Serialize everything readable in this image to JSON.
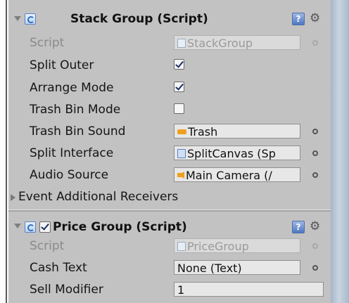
{
  "components": [
    {
      "title": "Stack Group (Script)",
      "has_checkbox": false,
      "rows": [
        {
          "label": "Script",
          "type": "object",
          "value": "StackGroup",
          "icon": "script-icon",
          "disabled": true
        },
        {
          "label": "Split Outer",
          "type": "checkbox",
          "checked": true
        },
        {
          "label": "Arrange Mode",
          "type": "checkbox",
          "checked": true
        },
        {
          "label": "Trash Bin Mode",
          "type": "checkbox",
          "checked": false
        },
        {
          "label": "Trash Bin Sound",
          "type": "object",
          "value": "Trash",
          "icon": "audio-clip-icon"
        },
        {
          "label": "Split Interface",
          "type": "object",
          "value": "SplitCanvas (Sp",
          "icon": "script-icon"
        },
        {
          "label": "Audio Source",
          "type": "object",
          "value": "Main Camera (/",
          "icon": "audio-source-icon"
        },
        {
          "label": "Event Additional Receivers",
          "type": "foldout"
        }
      ]
    },
    {
      "title": "Price Group (Script)",
      "has_checkbox": true,
      "checked": true,
      "rows": [
        {
          "label": "Script",
          "type": "object",
          "value": "PriceGroup",
          "icon": "script-icon",
          "disabled": true
        },
        {
          "label": "Cash Text",
          "type": "object",
          "value": "None (Text)"
        },
        {
          "label": "Sell Modifier",
          "type": "number",
          "value": "1"
        }
      ]
    }
  ],
  "help_glyph": "?",
  "gear_glyph": "⚙",
  "colors": {
    "panel": "#c2c2c2",
    "accent": "#1a2f66",
    "scrollbar": "#b7c5d6"
  }
}
